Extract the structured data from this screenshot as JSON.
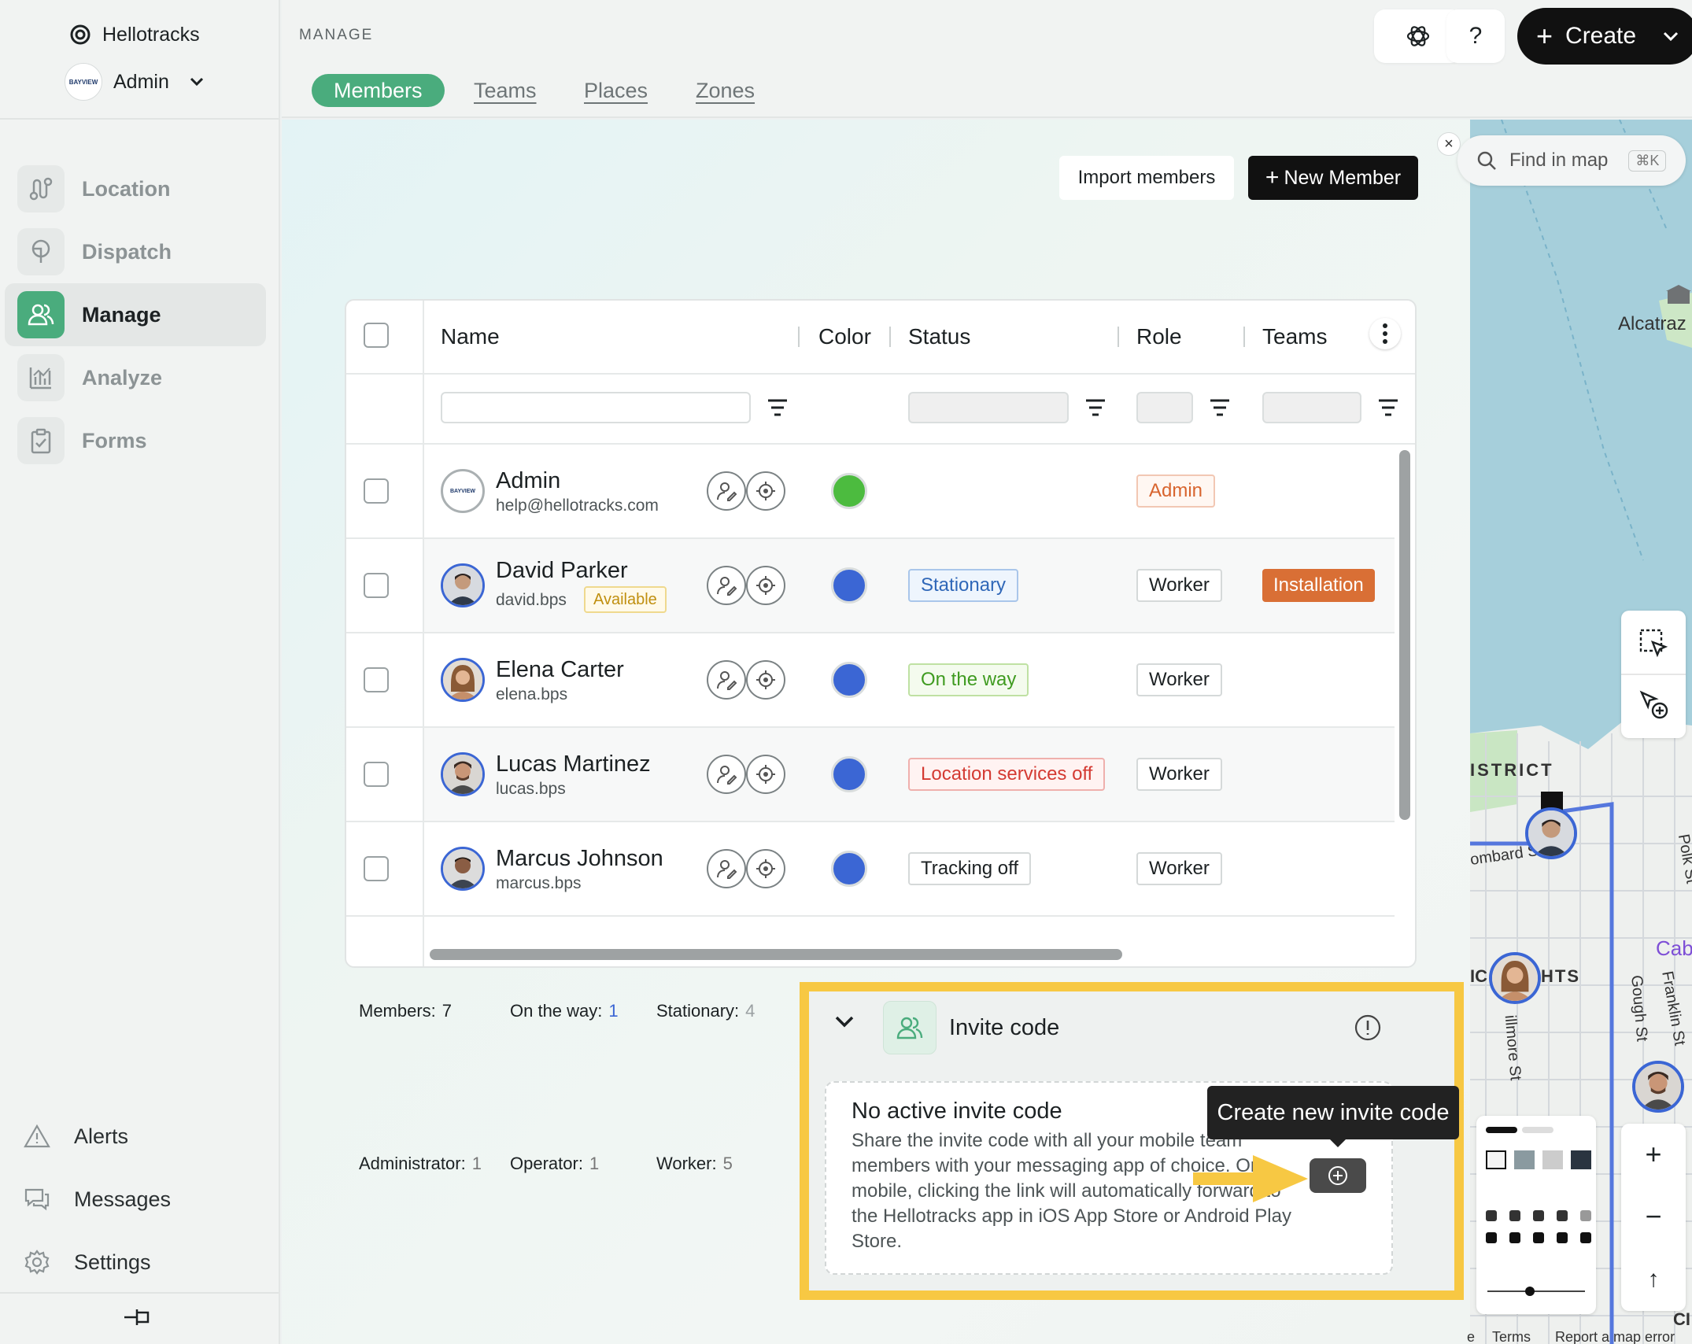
{
  "brand": {
    "name": "Hellotracks"
  },
  "org": {
    "name": "Admin",
    "logo_text": "BAYVIEW"
  },
  "nav": [
    {
      "label": "Location",
      "icon": "route-icon"
    },
    {
      "label": "Dispatch",
      "icon": "dispatch-icon"
    },
    {
      "label": "Manage",
      "icon": "users-icon"
    },
    {
      "label": "Analyze",
      "icon": "chart-icon"
    },
    {
      "label": "Forms",
      "icon": "clipboard-icon"
    }
  ],
  "bottom_nav": [
    {
      "label": "Alerts",
      "icon": "warning-icon"
    },
    {
      "label": "Messages",
      "icon": "messages-icon"
    },
    {
      "label": "Settings",
      "icon": "gear-icon"
    }
  ],
  "header": {
    "section": "MANAGE",
    "tabs": [
      "Members",
      "Teams",
      "Places",
      "Zones"
    ],
    "help_label": "?",
    "create_label": "Create"
  },
  "actions": {
    "import_label": "Import members",
    "new_member_label": "New Member",
    "close_label": "×"
  },
  "table": {
    "columns": [
      "Name",
      "Color",
      "Status",
      "Role",
      "Teams"
    ],
    "rows": [
      {
        "name": "Admin",
        "sub": "help@hellotracks.com",
        "badge": "",
        "color": "#4cbb3f",
        "status": "",
        "role": "Admin",
        "team": ""
      },
      {
        "name": "David Parker",
        "sub": "david.bps",
        "badge": "Available",
        "color": "#3b66d4",
        "status": "Stationary",
        "role": "Worker",
        "team": "Installation"
      },
      {
        "name": "Elena Carter",
        "sub": "elena.bps",
        "badge": "",
        "color": "#3b66d4",
        "status": "On the way",
        "role": "Worker",
        "team": ""
      },
      {
        "name": "Lucas Martinez",
        "sub": "lucas.bps",
        "badge": "",
        "color": "#3b66d4",
        "status": "Location services off",
        "role": "Worker",
        "team": ""
      },
      {
        "name": "Marcus Johnson",
        "sub": "marcus.bps",
        "badge": "",
        "color": "#3b66d4",
        "status": "Tracking off",
        "role": "Worker",
        "team": ""
      }
    ]
  },
  "summary": {
    "members_label": "Members:",
    "members": "7",
    "on_way_label": "On the way:",
    "on_way": "1",
    "stationary_label": "Stationary:",
    "stationary": "4",
    "admin_label": "Administrator:",
    "admin": "1",
    "operator_label": "Operator:",
    "operator": "1",
    "worker_label": "Worker:",
    "worker": "5"
  },
  "invite": {
    "title": "Invite code",
    "card_title": "No active invite code",
    "description": "Share the invite code with all your mobile team members with your messaging app of choice. On mobile, clicking the link will automatically forward to the Hellotracks app in iOS App Store or Android Play Store.",
    "tooltip": "Create new invite code"
  },
  "map": {
    "search_placeholder": "Find in map",
    "shortcut": "⌘K",
    "labels": {
      "alcatraz": "Alcatraz",
      "district": "ISTRICT",
      "lombard": "ombard S",
      "heights": "HTS",
      "ic": "IC",
      "fillmore": "illmore St",
      "gough": "Gough St",
      "franklin": "Franklin St",
      "polk": "Polk St",
      "cab": "Cab",
      "ci": "CI",
      "e": "e",
      "terms": "Terms",
      "report": "Report a map error"
    },
    "zoom_in": "+",
    "zoom_out": "−",
    "recenter": "↑"
  },
  "colors": {
    "accent": "#4aac7d",
    "highlight": "#f7c843",
    "member_blue": "#3b66d4"
  }
}
